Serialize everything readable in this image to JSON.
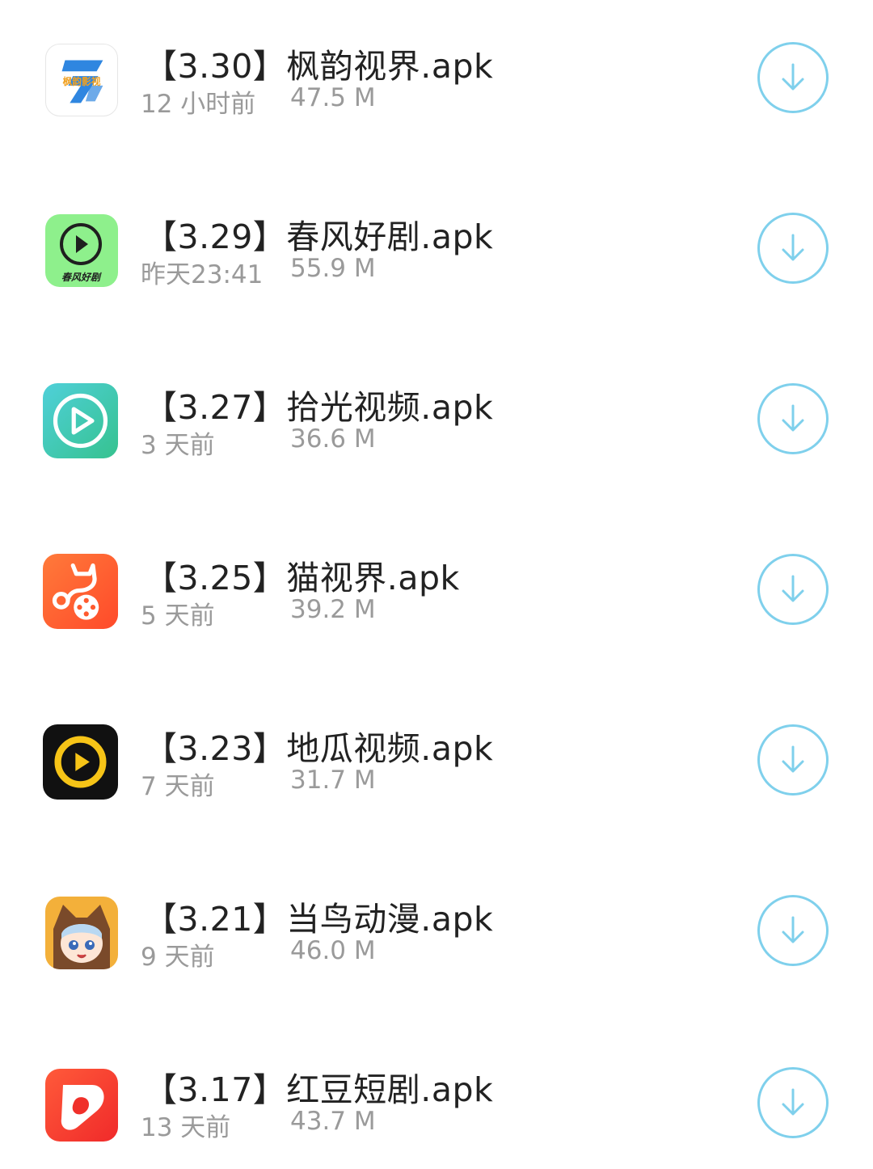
{
  "files": [
    {
      "title": "【3.30】枫韵视界.apk",
      "time": "12 小时前",
      "size": "47.5 M",
      "icon": "fengyun-app-icon",
      "icon_text": "枫韵影视"
    },
    {
      "title": "【3.29】春风好剧.apk",
      "time": "昨天23:41",
      "size": "55.9 M",
      "icon": "chunfeng-app-icon",
      "icon_text": "春风好剧"
    },
    {
      "title": "【3.27】拾光视频.apk",
      "time": "3 天前",
      "size": "36.6 M",
      "icon": "shiguang-app-icon"
    },
    {
      "title": "【3.25】猫视界.apk",
      "time": "5 天前",
      "size": "39.2 M",
      "icon": "maoshijie-app-icon"
    },
    {
      "title": "【3.23】地瓜视频.apk",
      "time": "7 天前",
      "size": "31.7 M",
      "icon": "digua-app-icon"
    },
    {
      "title": "【3.21】当鸟动漫.apk",
      "time": "9 天前",
      "size": "46.0 M",
      "icon": "dangniao-app-icon"
    },
    {
      "title": "【3.17】红豆短剧.apk",
      "time": "13 天前",
      "size": "43.7 M",
      "icon": "hongdou-app-icon"
    }
  ],
  "download_icon": "download-arrow-icon",
  "colors": {
    "accent": "#7fd0ec",
    "title": "#222222",
    "meta": "#9a9a9a",
    "background": "#ffffff"
  }
}
